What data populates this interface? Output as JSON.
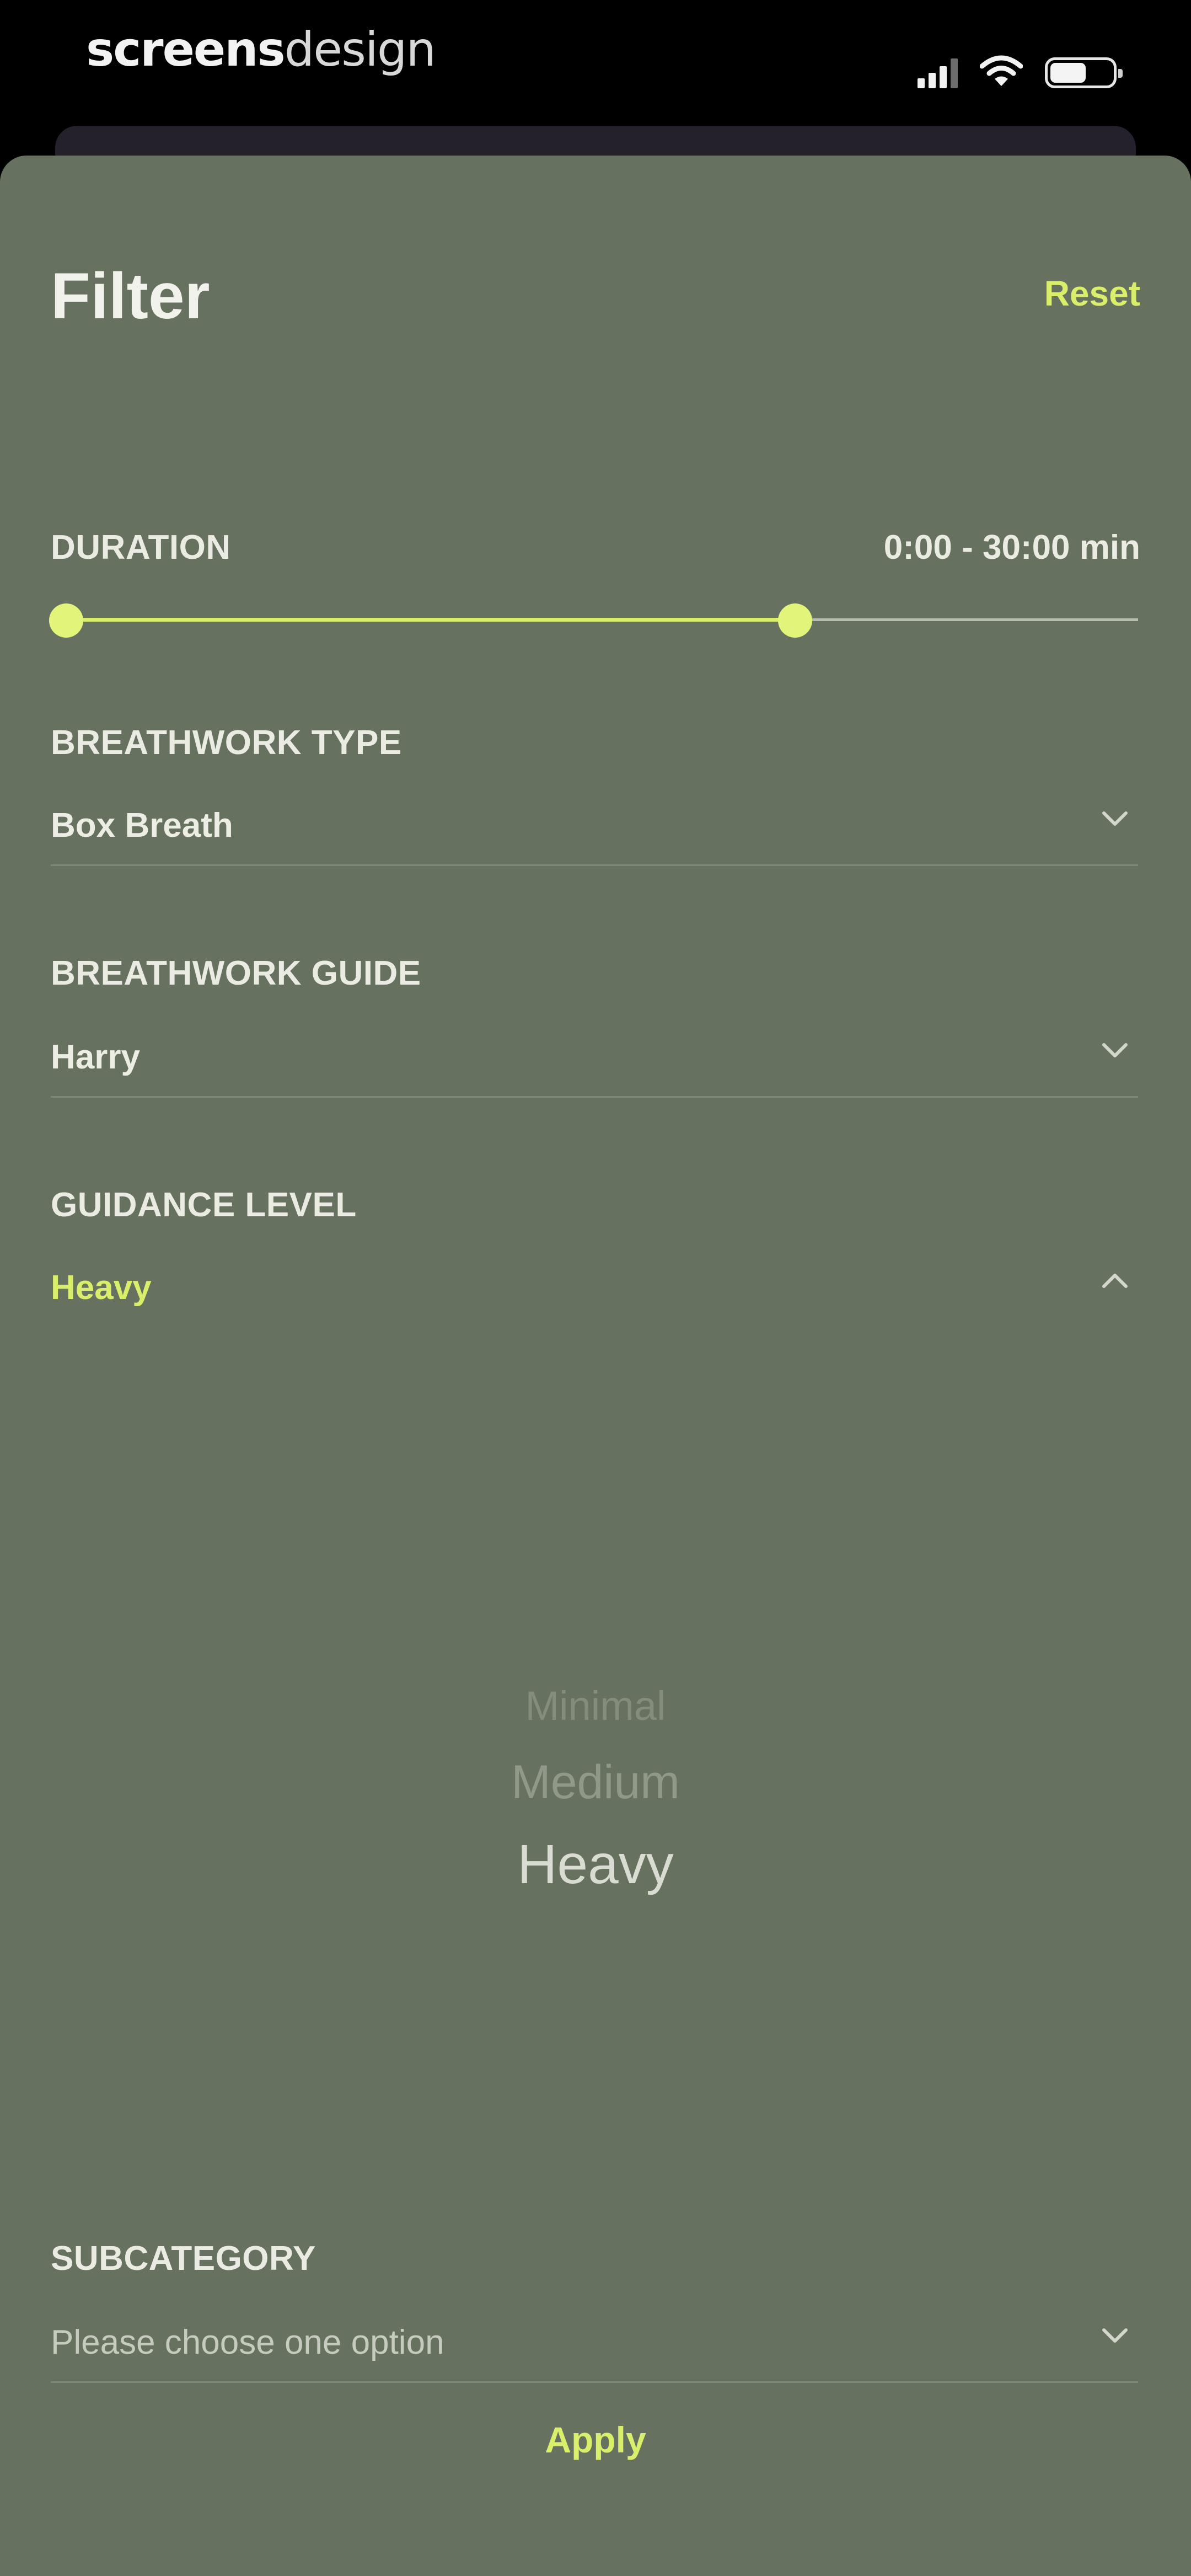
{
  "status_bar": {
    "brand_bold": "screens",
    "brand_light": "design",
    "icons": [
      "signal-icon",
      "wifi-icon",
      "battery-icon"
    ]
  },
  "filter": {
    "title": "Filter",
    "reset_label": "Reset",
    "duration": {
      "label": "DURATION",
      "value_text": "0:00 - 30:00 min",
      "range_start_fraction": 0.0,
      "range_end_fraction": 0.68
    },
    "breathwork_type": {
      "label": "BREATHWORK TYPE",
      "value": "Box Breath"
    },
    "breathwork_guide": {
      "label": "BREATHWORK GUIDE",
      "value": "Harry"
    },
    "guidance_level": {
      "label": "GUIDANCE LEVEL",
      "value": "Heavy",
      "expanded": true,
      "options": [
        "Minimal",
        "Medium",
        "Heavy"
      ],
      "selected_index": 2
    },
    "subcategory": {
      "label": "SUBCATEGORY",
      "placeholder": "Please choose one option"
    },
    "apply_label": "Apply"
  },
  "colors": {
    "sheet_background": "#667160",
    "accent": "#d9ef6b",
    "text": "#eaebe3"
  }
}
